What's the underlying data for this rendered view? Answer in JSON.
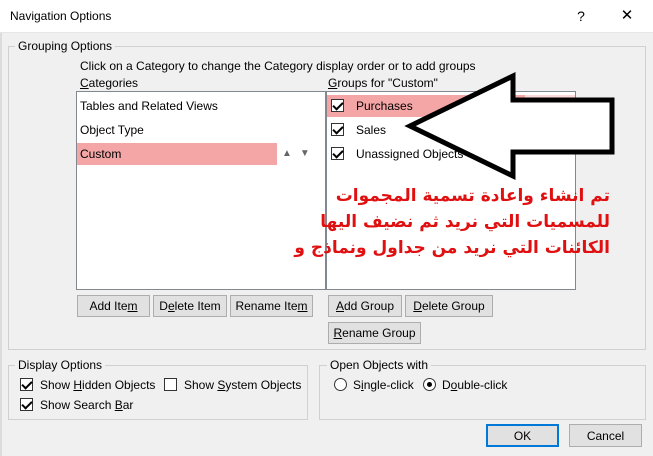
{
  "window": {
    "title": "Navigation Options",
    "help": "?",
    "close": "✕"
  },
  "grouping": {
    "legend": "Grouping Options",
    "instruction": "Click on a Category to change the Category display order or to add groups",
    "categories_label_u": "C",
    "categories_label_rest": "ategories",
    "groups_label_u": "G",
    "groups_label_rest": "roups for \"Custom\"",
    "categories": [
      {
        "label": "Tables and Related Views"
      },
      {
        "label": "Object Type"
      },
      {
        "label": "Custom"
      }
    ],
    "groups": [
      {
        "label": "Purchases",
        "checked": true
      },
      {
        "label": "Sales",
        "checked": true
      },
      {
        "label": "Unassigned Objects",
        "checked": true
      }
    ],
    "arrow_up": "▲",
    "arrow_down": "▼",
    "buttons": {
      "add_item": "Add Ite",
      "add_item_u": "m",
      "delete_item_a": "D",
      "delete_item_u": "e",
      "delete_item_b": "lete Item",
      "rename_item_a": "Rename Ite",
      "rename_item_u": "m",
      "add_group_u": "A",
      "add_group_b": "dd Group",
      "delete_group_u": "D",
      "delete_group_b": "elete Group",
      "rename_group_u": "R",
      "rename_group_b": "ename Group"
    }
  },
  "annotation": {
    "line1": "تم انشاء واعادة تسمية المجموات",
    "line2": "للمسميات التي نريد ثم نضيف اليها",
    "line3": "الكائنات التي نريد من جداول ونماذج و",
    "color": "#e01010"
  },
  "display": {
    "legend": "Display Options",
    "show_hidden_a": "Show ",
    "show_hidden_u": "H",
    "show_hidden_b": "idden Objects",
    "show_hidden_checked": true,
    "show_system_a": "Show ",
    "show_system_u": "S",
    "show_system_b": "ystem Objects",
    "show_system_checked": false,
    "show_search_a": "Show Search ",
    "show_search_u": "B",
    "show_search_b": "ar",
    "show_search_checked": true
  },
  "open_objects": {
    "legend": "Open Objects with",
    "single_a": "S",
    "single_u": "i",
    "single_b": "ngle-click",
    "single_selected": false,
    "double_a": "D",
    "double_u": "o",
    "double_b": "uble-click",
    "double_selected": true
  },
  "footer": {
    "ok": "OK",
    "cancel": "Cancel"
  }
}
